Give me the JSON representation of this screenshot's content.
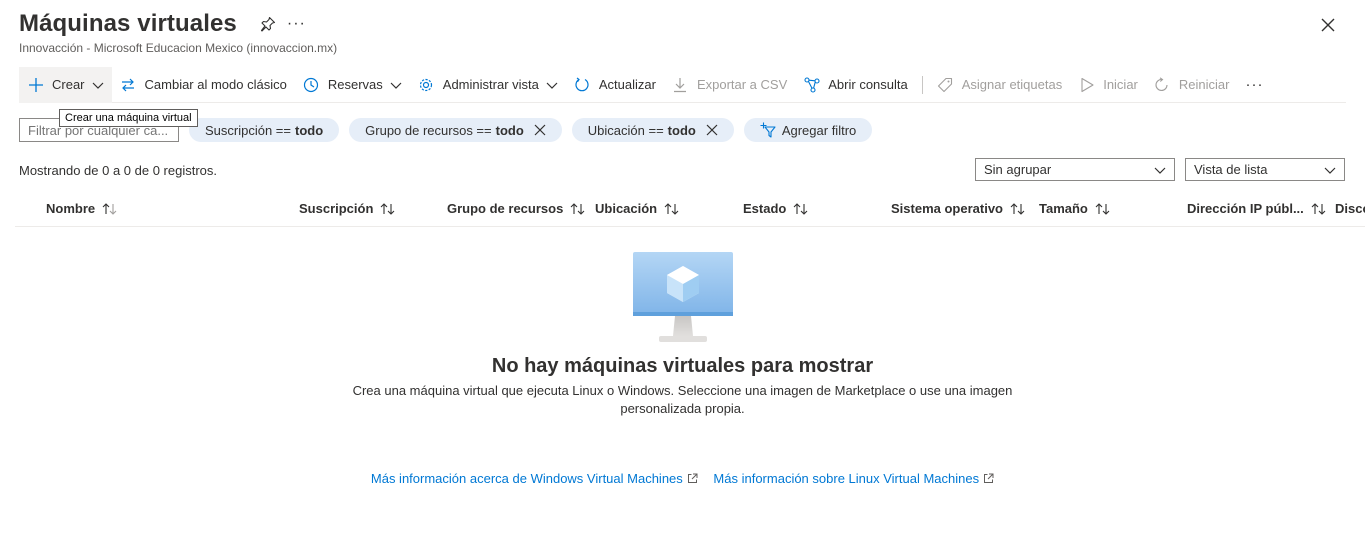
{
  "header": {
    "title": "Máquinas virtuales",
    "subtitle": "Innovacción - Microsoft Educacion Mexico (innovaccion.mx)",
    "more": "···"
  },
  "toolbar": {
    "create": "Crear",
    "classic": "Cambiar al modo clásico",
    "reservations": "Reservas",
    "manage_view": "Administrar vista",
    "refresh": "Actualizar",
    "export": "Exportar a CSV",
    "query": "Abrir consulta",
    "tags": "Asignar etiquetas",
    "start": "Iniciar",
    "restart": "Reiniciar",
    "more": "···"
  },
  "tooltip": "Crear una máquina virtual",
  "filters": {
    "search_placeholder": "Filtrar por cualquier ca...",
    "subscription": {
      "label": "Suscripción ==",
      "value": "todo"
    },
    "resource_group": {
      "label": "Grupo de recursos ==",
      "value": "todo"
    },
    "location": {
      "label": "Ubicación ==",
      "value": "todo"
    },
    "add": "Agregar filtro"
  },
  "records": "Mostrando de 0 a 0 de 0 registros.",
  "grouping": "Sin agrupar",
  "view": "Vista de lista",
  "columns": {
    "name": "Nombre",
    "subscription": "Suscripción",
    "resource_group": "Grupo de recursos",
    "location": "Ubicación",
    "status": "Estado",
    "os": "Sistema operativo",
    "size": "Tamaño",
    "public_ip": "Dirección IP públ...",
    "disks": "Disco"
  },
  "empty": {
    "title": "No hay máquinas virtuales para mostrar",
    "desc_line1": "Crea una máquina virtual que ejecuta Linux o Windows. Seleccione una imagen de Marketplace o use una imagen",
    "desc_line2": "personalizada propia."
  },
  "links": {
    "windows": "Más información acerca de Windows Virtual Machines",
    "linux": "Más información sobre Linux Virtual Machines"
  },
  "colors": {
    "accent": "#0078d4",
    "pill_bg": "#e6eef8",
    "disabled": "#a19f9d"
  }
}
